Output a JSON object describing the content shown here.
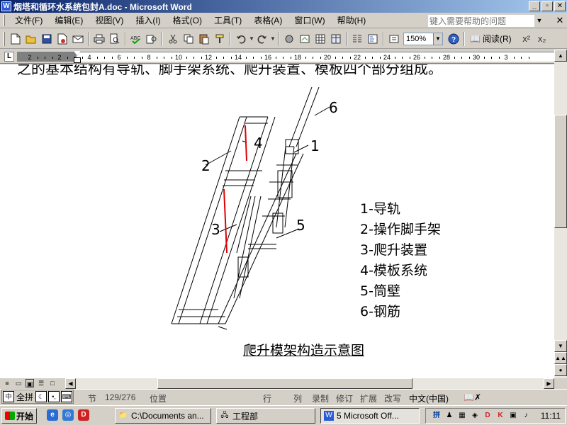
{
  "window": {
    "title": "烟塔和循环水系统包封A.doc - Microsoft Word",
    "minimize": "_",
    "restore": "▫",
    "close": "✕"
  },
  "menu": {
    "items": [
      "文件(F)",
      "编辑(E)",
      "视图(V)",
      "插入(I)",
      "格式(O)",
      "工具(T)",
      "表格(A)",
      "窗口(W)",
      "帮助(H)"
    ],
    "help_placeholder": "键入需要帮助的问题",
    "doc_close": "✕"
  },
  "toolbar": {
    "zoom": "150%",
    "read_label": "阅读(R)",
    "superscript": "x²",
    "subscript": "x₂"
  },
  "ruler": {
    "labels": [
      "2",
      "2",
      "4",
      "6",
      "8",
      "10",
      "12",
      "14",
      "16",
      "18",
      "20",
      "22",
      "24",
      "26",
      "28",
      "30",
      "3"
    ]
  },
  "document": {
    "top_line": "之的基本结构有导轨、脚手架系统、爬升装置、模板四个部分组成。",
    "figure_labels": [
      "1",
      "2",
      "3",
      "4",
      "5",
      "6"
    ],
    "legend": [
      "1-导轨",
      "2-操作脚手架",
      "3-爬升装置",
      "4-模板系统",
      "5-筒壁",
      "6-钢筋"
    ],
    "caption": "爬升模架构造示意图"
  },
  "statusbar": {
    "section": "节",
    "page": "129/276",
    "position": "位置",
    "line": "行",
    "column": "列",
    "rec": "录制",
    "trk": "修订",
    "ext": "扩展",
    "ovr": "改写",
    "language": "中文(中国)",
    "ime": {
      "full": "全拼"
    }
  },
  "taskbar": {
    "start": "开始",
    "tasks": [
      "C:\\Documents an...",
      "工程部",
      "5 Microsoft Off..."
    ],
    "clock": "11:11"
  },
  "colors": {
    "title_start": "#0a246a",
    "title_end": "#a6caf0",
    "chrome": "#d4d0c8",
    "red_marks": "#e00000"
  }
}
